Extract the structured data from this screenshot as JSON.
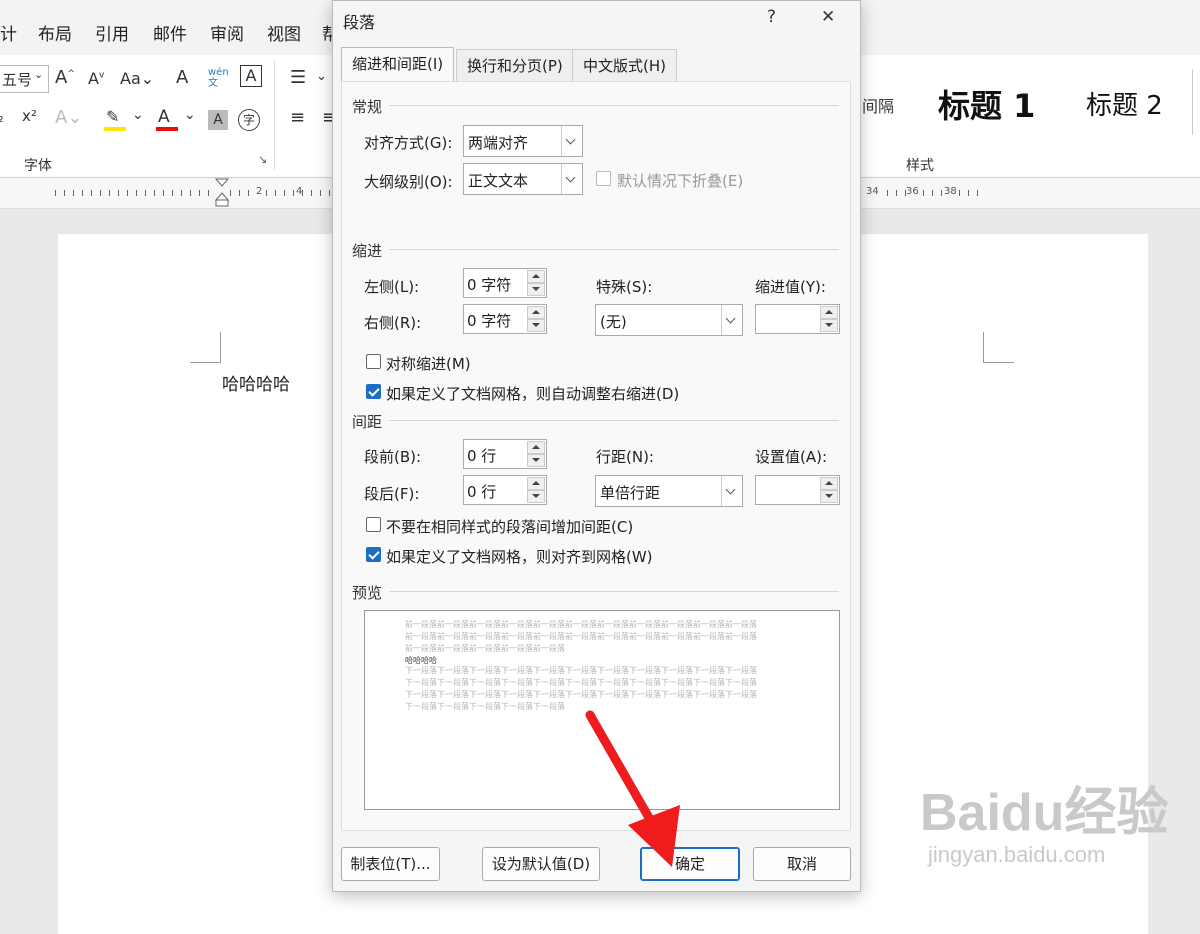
{
  "ribbon": {
    "menu": [
      "计",
      "布局",
      "引用",
      "邮件",
      "审阅",
      "视图",
      "帮"
    ],
    "font_size": "五号",
    "group_font": "字体",
    "group_style": "样式",
    "style_partial": "间隔",
    "style_h1": "标题 1",
    "style_h2": "标题 2",
    "ruler_nums": [
      "2",
      "4",
      "34",
      "36",
      "38"
    ]
  },
  "document": {
    "text": "哈哈哈哈"
  },
  "dialog": {
    "title": "段落",
    "help": "?",
    "close": "✕",
    "tabs": [
      "缩进和间距(I)",
      "换行和分页(P)",
      "中文版式(H)"
    ],
    "general": {
      "heading": "常规",
      "alignment_label": "对齐方式(G):",
      "alignment_value": "两端对齐",
      "outline_label": "大纲级别(O):",
      "outline_value": "正文文本",
      "collapse_label": "默认情况下折叠(E)"
    },
    "indent": {
      "heading": "缩进",
      "left_label": "左侧(L):",
      "left_value": "0 字符",
      "right_label": "右侧(R):",
      "right_value": "0 字符",
      "special_label": "特殊(S):",
      "special_value": "(无)",
      "indent_by_label": "缩进值(Y):",
      "mirror_label": "对称缩进(M)",
      "mirror_checked": false,
      "auto_adjust_label": "如果定义了文档网格，则自动调整右缩进(D)",
      "auto_adjust_checked": true
    },
    "spacing": {
      "heading": "间距",
      "before_label": "段前(B):",
      "before_value": "0 行",
      "after_label": "段后(F):",
      "after_value": "0 行",
      "line_label": "行距(N):",
      "line_value": "单倍行距",
      "at_label": "设置值(A):",
      "no_space_label": "不要在相同样式的段落间增加间距(C)",
      "no_space_checked": false,
      "snap_grid_label": "如果定义了文档网格，则对齐到网格(W)",
      "snap_grid_checked": true
    },
    "preview": {
      "heading": "预览",
      "prev_lines": [
        "前一段落前一段落前一段落前一段落前一段落前一段落前一段落前一段落前一段落前一段落前一段落",
        "前一段落前一段落前一段落前一段落前一段落前一段落前一段落前一段落前一段落前一段落前一段落",
        "前一段落前一段落前一段落前一段落前一段落"
      ],
      "current": "哈哈哈哈",
      "next_lines": [
        "下一段落下一段落下一段落下一段落下一段落下一段落下一段落下一段落下一段落下一段落下一段落",
        "下一段落下一段落下一段落下一段落下一段落下一段落下一段落下一段落下一段落下一段落下一段落",
        "下一段落下一段落下一段落下一段落下一段落下一段落下一段落下一段落下一段落下一段落下一段落",
        "下一段落下一段落下一段落下一段落下一段落"
      ]
    },
    "buttons": {
      "tabs": "制表位(T)...",
      "default": "设为默认值(D)",
      "ok": "确定",
      "cancel": "取消"
    }
  },
  "watermark": {
    "brand": "Baidu经验",
    "url": "jingyan.baidu.com"
  },
  "colors": {
    "accent": "#1a6fc4",
    "annotation_arrow": "#ee1c1c"
  }
}
